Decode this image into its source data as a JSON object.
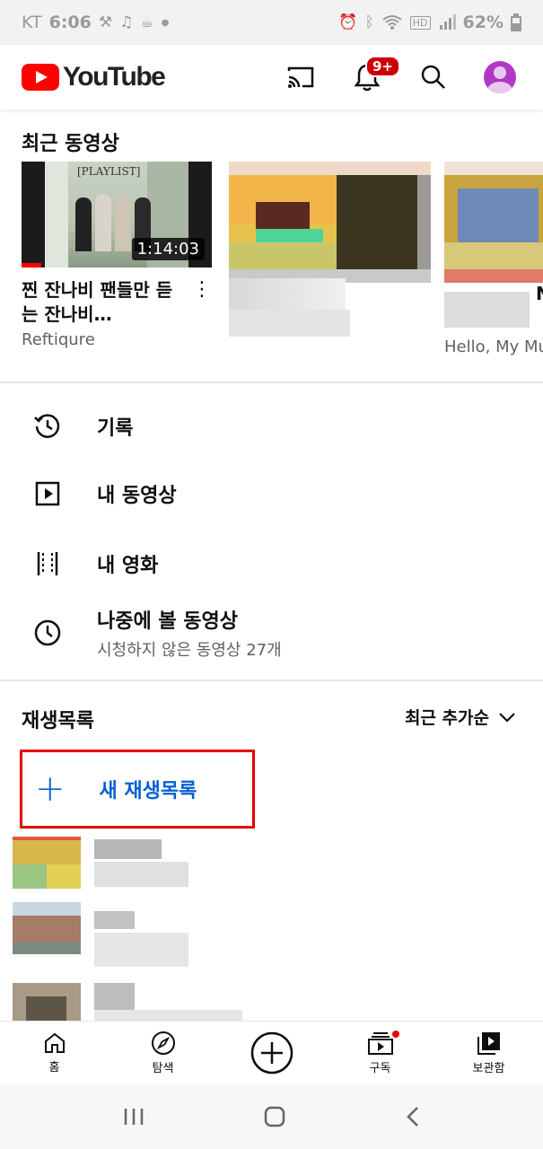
{
  "status_bar": {
    "carrier": "KT",
    "time": "6:06",
    "battery": "62%",
    "left_icons": [
      "wrench-icon",
      "music-note-icon",
      "coffee-icon",
      "dot-icon"
    ],
    "right_icons": [
      "alarm-icon",
      "bluetooth-icon",
      "wifi-icon",
      "hd-icon",
      "signal-icon",
      "battery-icon"
    ]
  },
  "app_bar": {
    "logo_text": "YouTube",
    "notification_badge": "9+"
  },
  "recent": {
    "title": "최근 동영상",
    "videos": [
      {
        "title": "찐 잔나비 팬들만 듣는 잔나비…",
        "channel": "Reftiqure",
        "duration": "1:14:03",
        "thumb_caption": "[PLAYLIST]"
      },
      {
        "title": "",
        "channel": "",
        "duration": ""
      },
      {
        "title": "N",
        "channel": "Hello, My Mu",
        "duration": ""
      }
    ]
  },
  "library_menu": [
    {
      "label": "기록",
      "sub": "",
      "icon": "history-icon"
    },
    {
      "label": "내 동영상",
      "sub": "",
      "icon": "play-square-icon"
    },
    {
      "label": "내 영화",
      "sub": "",
      "icon": "film-strip-icon"
    },
    {
      "label": "나중에 볼 동영상",
      "sub": "시청하지 않은 동영상 27개",
      "icon": "clock-icon"
    }
  ],
  "playlists": {
    "title": "재생목록",
    "sort_label": "최근 추가순",
    "new_playlist_label": "새 재생목록"
  },
  "bottom_nav": [
    {
      "label": "홈",
      "icon": "home-icon"
    },
    {
      "label": "탐색",
      "icon": "compass-icon"
    },
    {
      "label": "",
      "icon": "create-plus-icon"
    },
    {
      "label": "구독",
      "icon": "subscriptions-icon"
    },
    {
      "label": "보관함",
      "icon": "library-icon"
    }
  ],
  "colors": {
    "brand_red": "#ff0000",
    "link_blue": "#065fd4",
    "highlight_box": "#e60000"
  }
}
